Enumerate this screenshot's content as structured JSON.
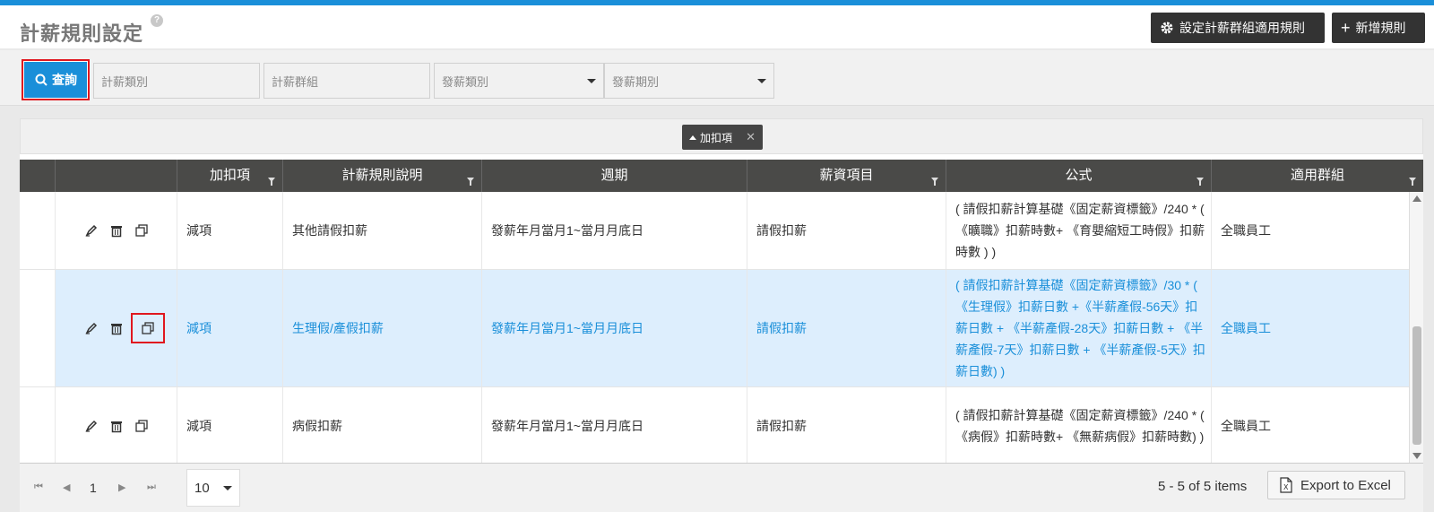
{
  "page": {
    "title": "計薪規則設定",
    "help_icon": "?"
  },
  "header": {
    "group_rule_button": "設定計薪群組適用規則",
    "add_rule_button": "新增規則",
    "add_icon": "+"
  },
  "filters": {
    "query_button": "查詢",
    "salary_category": "計薪類別",
    "salary_group": "計薪群組",
    "payroll_type": "發薪類別",
    "payroll_period": "發薪期別"
  },
  "grouping": {
    "chip_label": "加扣項",
    "close": "✕"
  },
  "table": {
    "columns": [
      "加扣項",
      "計薪規則說明",
      "週期",
      "薪資項目",
      "公式",
      "適用群組"
    ],
    "rows": [
      {
        "type": "減項",
        "description": "其他請假扣薪",
        "period": "發薪年月當月1~當月月底日",
        "item": "請假扣薪",
        "formula": "( 請假扣薪計算基礎《固定薪資標籤》/240 * ( 《曠職》扣薪時數+ 《育嬰縮短工時假》扣薪時數 ) )",
        "group": "全職員工"
      },
      {
        "type": "減項",
        "description": "生理假/產假扣薪",
        "period": "發薪年月當月1~當月月底日",
        "item": "請假扣薪",
        "formula": "( 請假扣薪計算基礎《固定薪資標籤》/30 * ( 《生理假》扣薪日數 +《半薪產假-56天》扣薪日數 + 《半薪產假-28天》扣薪日數 + 《半薪產假-7天》扣薪日數 + 《半薪產假-5天》扣薪日數) )",
        "group": "全職員工"
      },
      {
        "type": "減項",
        "description": "病假扣薪",
        "period": "發薪年月當月1~當月月底日",
        "item": "請假扣薪",
        "formula": "( 請假扣薪計算基礎《固定薪資標籤》/240 * ( 《病假》扣薪時數+ 《無薪病假》扣薪時數) )",
        "group": "全職員工"
      }
    ]
  },
  "pager": {
    "current_page": "1",
    "page_size": "10",
    "items_info": "5 - 5 of 5 items",
    "export_button": "Export to Excel"
  },
  "colors": {
    "accent": "#1a8fd9",
    "highlight_box": "#e0171f",
    "header_dark": "#333333",
    "table_header": "#4a4a48",
    "selected_row": "#ddeefd"
  }
}
